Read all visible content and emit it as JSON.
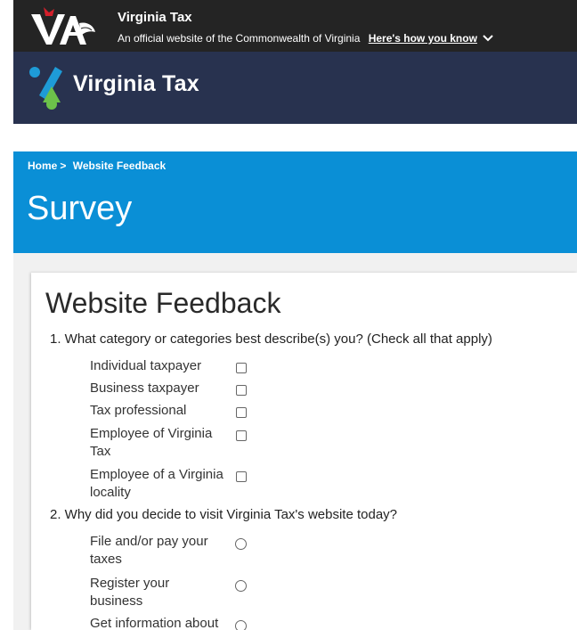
{
  "gov_banner": {
    "title": "Virginia Tax",
    "subtitle": "An official website of the Commonwealth of Virginia",
    "how_you_know": "Here's how you know"
  },
  "header": {
    "logo_text": "Virginia Tax"
  },
  "breadcrumb": {
    "home": "Home",
    "separator": ">",
    "current": "Website Feedback"
  },
  "hero": {
    "title": "Survey"
  },
  "form": {
    "title": "Website Feedback",
    "q1": {
      "label": "1. What category or categories best describe(s) you? (Check all that apply)",
      "options": [
        "Individual taxpayer",
        "Business taxpayer",
        "Tax professional",
        "Employee of Virginia Tax",
        "Employee of a Virginia locality"
      ]
    },
    "q2": {
      "label": "2. Why did you decide to visit Virginia Tax's website today?",
      "options": [
        "File and/or pay your taxes",
        "Register your business",
        "Get information about"
      ]
    }
  },
  "colors": {
    "gov_banner_bg": "#242424",
    "header_bg": "#28324f",
    "hero_bg": "#0a8fd6",
    "logo_blue": "#1e9bd7",
    "logo_green": "#6cc24a"
  }
}
